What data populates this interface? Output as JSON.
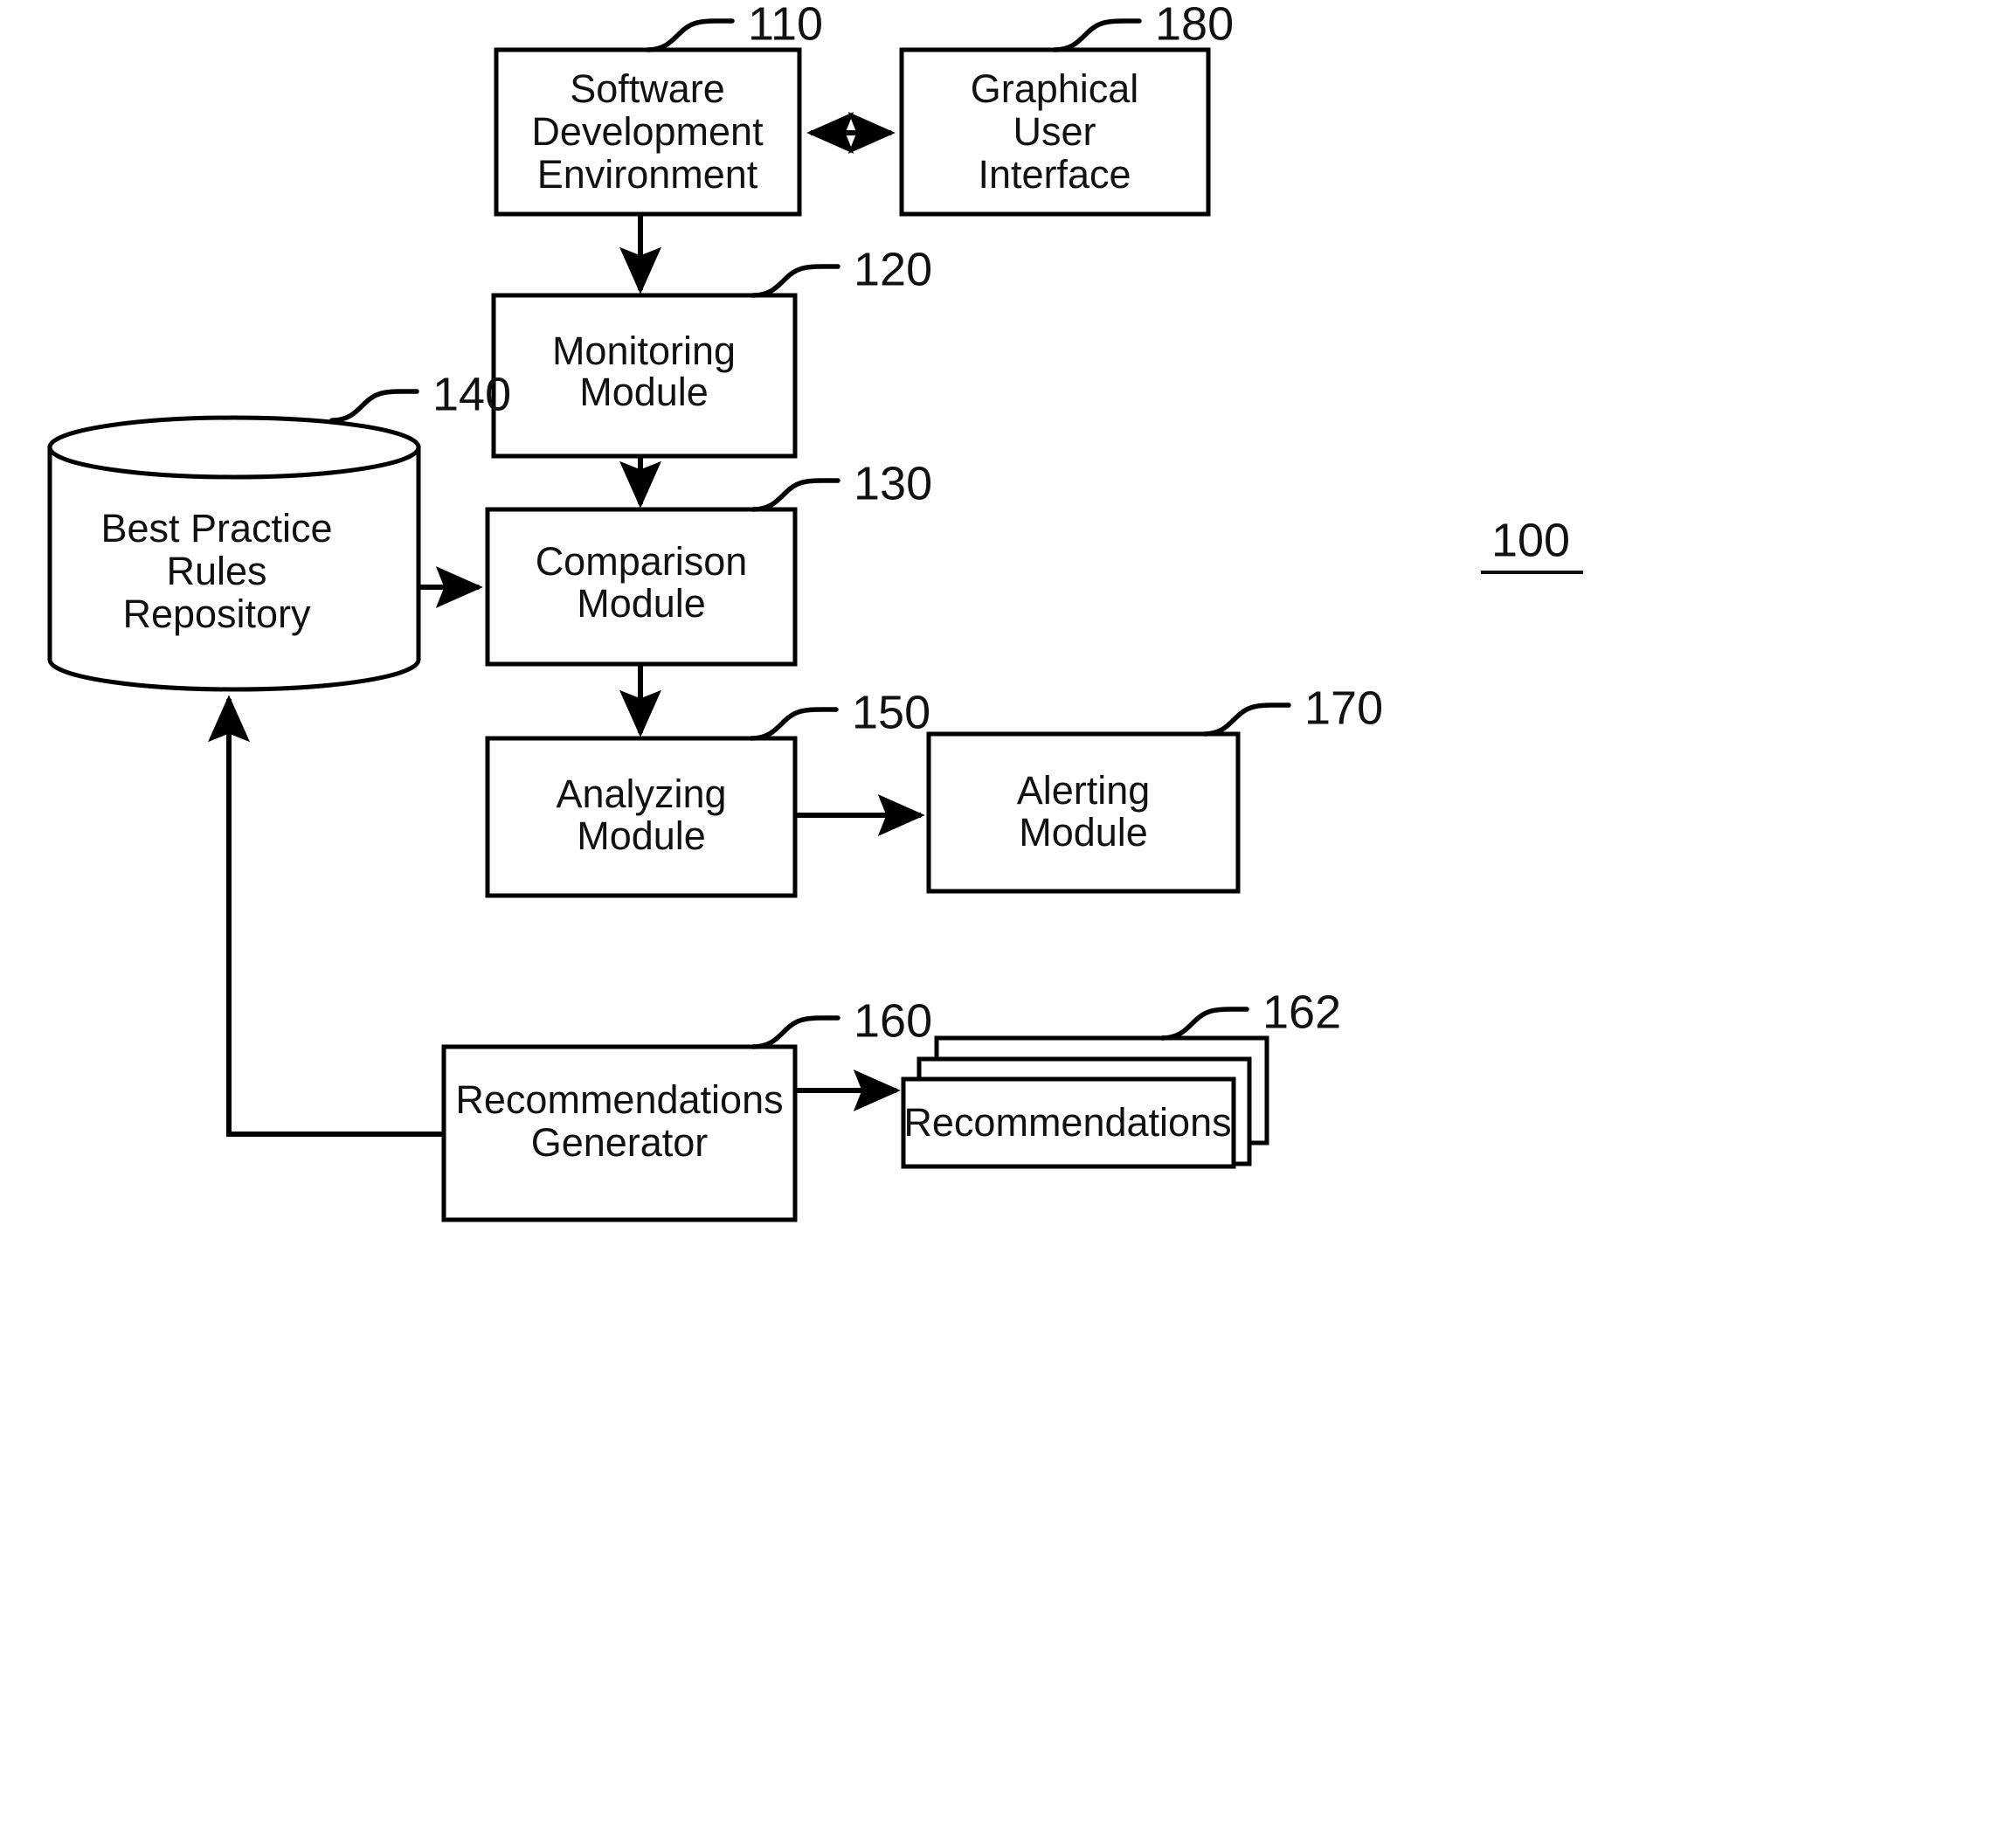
{
  "figure": {
    "system_reference": "100",
    "nodes": [
      {
        "id": "sde",
        "ref": "110",
        "lines": [
          "Software",
          "Development",
          "Environment"
        ],
        "shape": "rect"
      },
      {
        "id": "gui",
        "ref": "180",
        "lines": [
          "Graphical",
          "User",
          "Interface"
        ],
        "shape": "rect"
      },
      {
        "id": "monitoring",
        "ref": "120",
        "lines": [
          "Monitoring",
          "Module"
        ],
        "shape": "rect"
      },
      {
        "id": "repository",
        "ref": "140",
        "lines": [
          "Best Practice",
          "Rules",
          "Repository"
        ],
        "shape": "cylinder"
      },
      {
        "id": "comparison",
        "ref": "130",
        "lines": [
          "Comparison",
          "Module"
        ],
        "shape": "rect"
      },
      {
        "id": "analyzing",
        "ref": "150",
        "lines": [
          "Analyzing",
          "Module"
        ],
        "shape": "rect"
      },
      {
        "id": "alerting",
        "ref": "170",
        "lines": [
          "Alerting",
          "Module"
        ],
        "shape": "rect"
      },
      {
        "id": "generator",
        "ref": "160",
        "lines": [
          "Recommendations",
          "Generator"
        ],
        "shape": "rect"
      },
      {
        "id": "recommendations",
        "ref": "162",
        "lines": [
          "Recommendations"
        ],
        "shape": "stacked-rect"
      }
    ],
    "connections": [
      {
        "from": "sde",
        "to": "gui",
        "style": "double-arrow"
      },
      {
        "from": "sde",
        "to": "monitoring",
        "style": "arrow"
      },
      {
        "from": "monitoring",
        "to": "comparison",
        "style": "arrow"
      },
      {
        "from": "repository",
        "to": "comparison",
        "style": "arrow"
      },
      {
        "from": "comparison",
        "to": "analyzing",
        "style": "arrow"
      },
      {
        "from": "analyzing",
        "to": "alerting",
        "style": "arrow"
      },
      {
        "from": "generator",
        "to": "recommendations",
        "style": "arrow"
      },
      {
        "from": "generator",
        "to": "repository",
        "style": "arrow"
      }
    ],
    "colors": {
      "stroke": "#000000",
      "fill": "#ffffff",
      "text": "#111111"
    }
  }
}
